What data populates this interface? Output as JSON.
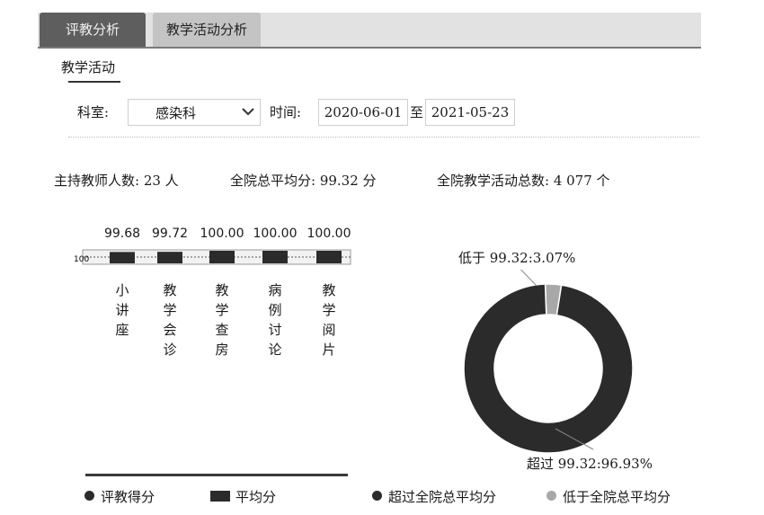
{
  "tabs": [
    {
      "label": "评教分析",
      "active": true
    },
    {
      "label": "教学活动分析",
      "active": false
    }
  ],
  "section_title": "教学活动",
  "filters": {
    "department_label": "科室:",
    "department_value": "感染科",
    "time_label": "时间:",
    "date_from": "2020-06-01",
    "date_sep": "至",
    "date_to": "2021-05-23"
  },
  "stats": {
    "teachers": "主持教师人数: 23 人",
    "avg_score": "全院总平均分: 99.32 分",
    "total_activities": "全院教学活动总数: 4 077 个"
  },
  "chart_data": [
    {
      "type": "bar",
      "categories": [
        "小讲座",
        "教学会诊",
        "教学查房",
        "病例讨论",
        "教学阅片"
      ],
      "category_display": [
        "小\n讲\n座",
        "教\n学\n会\n诊",
        "教\n学\n查\n房",
        "病\n例\n讨\n论",
        "教\n学\n阅\n片"
      ],
      "values": [
        99.68,
        99.72,
        100.0,
        100.0,
        100.0
      ],
      "value_labels": [
        "99.68",
        "99.72",
        "100.00",
        "100.00",
        "100.00"
      ],
      "axis_tick": "100",
      "legend": [
        "评教得分",
        "平均分"
      ]
    },
    {
      "type": "pie",
      "style": "donut",
      "slices": [
        {
          "name": "超过全院总平均分",
          "label": "超过 99.32:96.93%",
          "value": 96.93,
          "color": "#2b2b2b"
        },
        {
          "name": "低于全院总平均分",
          "label": "低于 99.32:3.07%",
          "value": 3.07,
          "color": "#a8a8a8"
        }
      ],
      "legend": [
        "超过全院总平均分",
        "低于全院总平均分"
      ]
    }
  ],
  "colors": {
    "dark": "#2b2b2b",
    "gray": "#a8a8a8",
    "tab_active": "#5e5e5e"
  }
}
